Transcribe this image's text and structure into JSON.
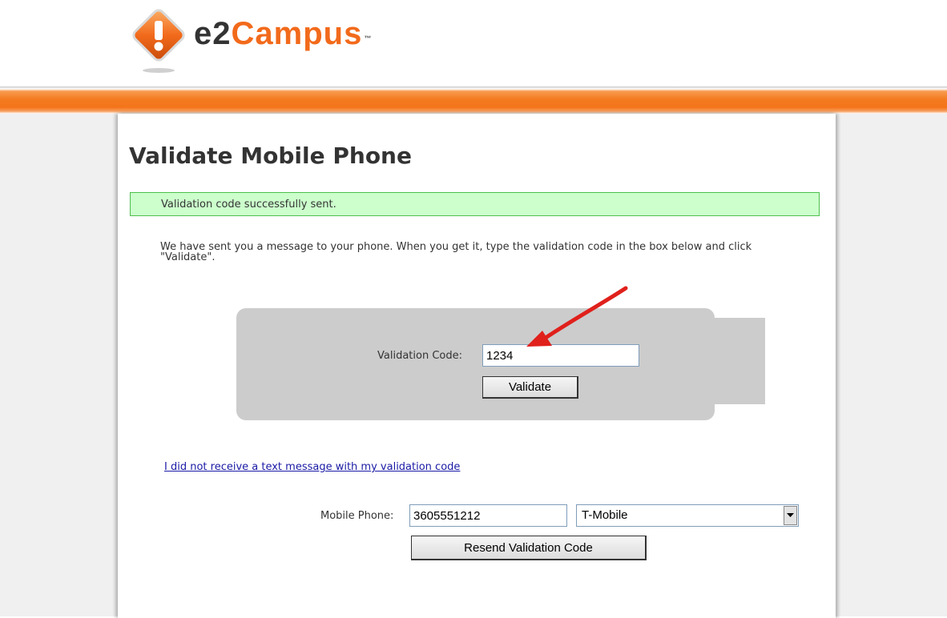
{
  "header": {
    "logo": {
      "brand_part1": "e2",
      "brand_part2": "Campus",
      "trademark": "™",
      "icon": "alert-diamond-icon"
    }
  },
  "page": {
    "title": "Validate Mobile Phone",
    "success_message": "Validation code successfully sent.",
    "instructions": "We have sent you a message to your phone. When you get it, type the validation code in the box below and click \"Validate\"."
  },
  "validation_form": {
    "code_label": "Validation Code:",
    "code_value": "1234",
    "validate_label": "Validate",
    "annotation_icon": "red-arrow-icon"
  },
  "resend": {
    "help_link": "I did not receive a text message with my validation code",
    "phone_label": "Mobile Phone:",
    "phone_value": "3605551212",
    "carrier_value": "T-Mobile",
    "resend_label": "Resend Validation Code"
  },
  "colors": {
    "brand_orange": "#f47b20",
    "success_bg": "#ccffcc",
    "success_border": "#4dbf4d",
    "link": "#1a1aa6",
    "annotation_red": "#e0201b"
  }
}
